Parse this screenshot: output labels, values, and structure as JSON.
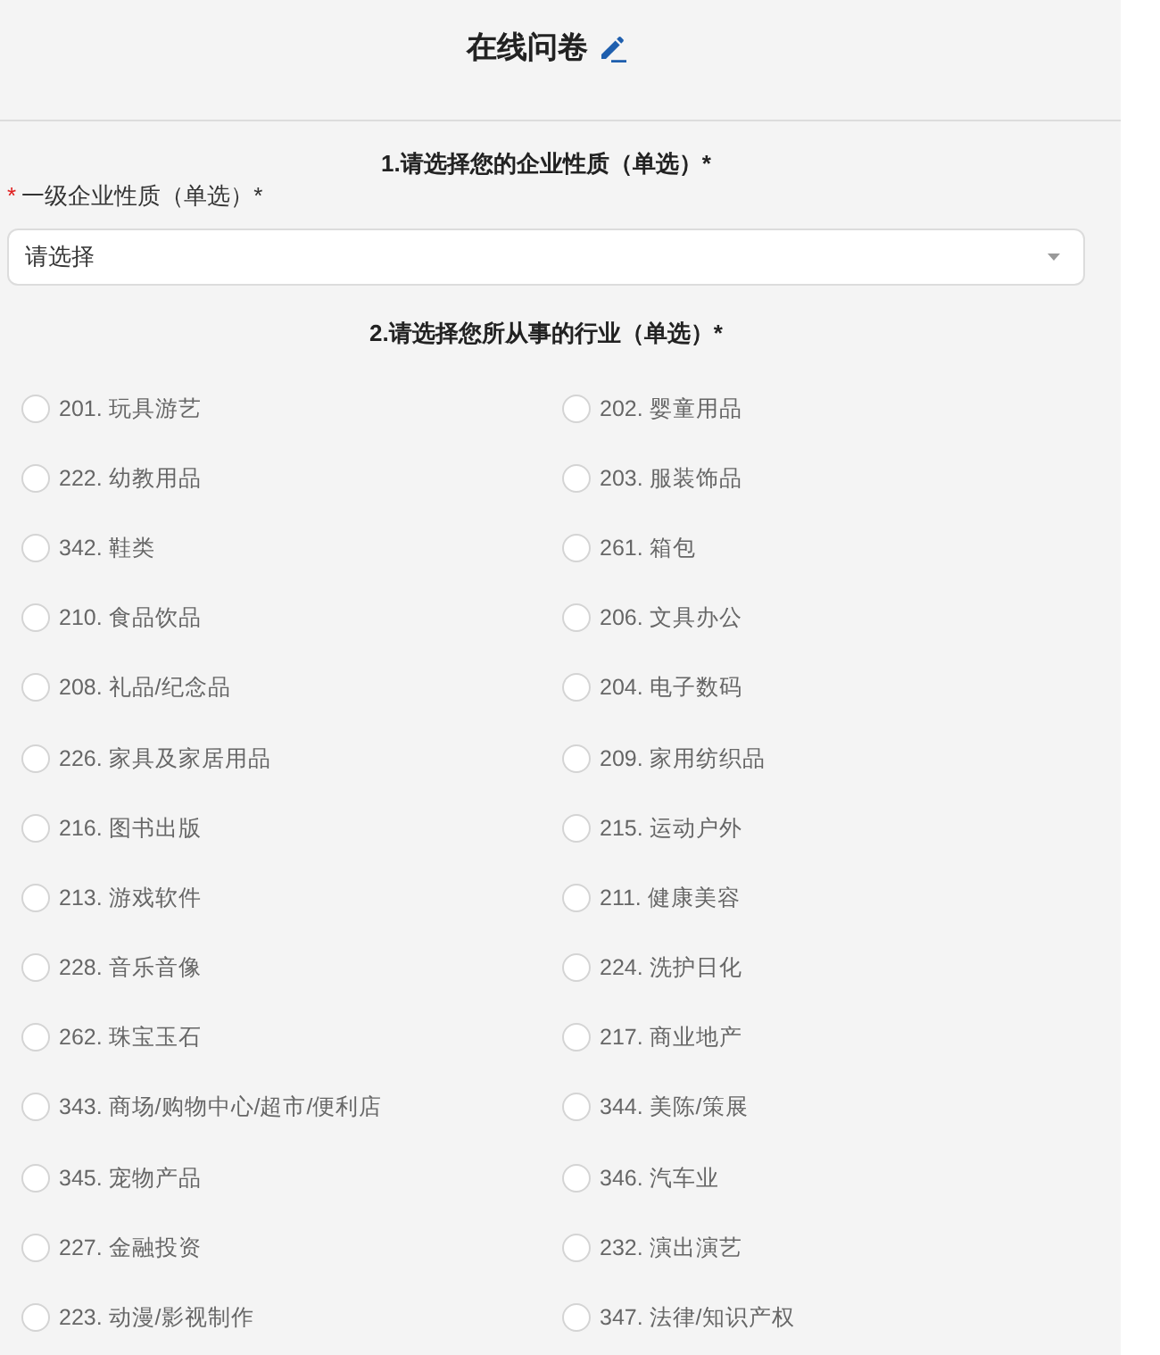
{
  "header": {
    "title": "在线问卷"
  },
  "questions": [
    {
      "kind": "select",
      "title": "1.请选择您的企业性质（单选）*",
      "field": {
        "required_mark": "*",
        "label": "一级企业性质（单选）*",
        "placeholder": "请选择"
      }
    },
    {
      "kind": "radio",
      "title": "2.请选择您所从事的行业（单选）*",
      "options": [
        {
          "label": "201. 玩具游艺",
          "selected": false
        },
        {
          "label": "202. 婴童用品",
          "selected": false
        },
        {
          "label": "222. 幼教用品",
          "selected": false
        },
        {
          "label": "203. 服装饰品",
          "selected": false
        },
        {
          "label": "342. 鞋类",
          "selected": false
        },
        {
          "label": "261. 箱包",
          "selected": false
        },
        {
          "label": "210. 食品饮品",
          "selected": false
        },
        {
          "label": "206. 文具办公",
          "selected": false
        },
        {
          "label": "208. 礼品/纪念品",
          "selected": false
        },
        {
          "label": "204. 电子数码",
          "selected": false
        },
        {
          "label": "226. 家具及家居用品",
          "selected": false
        },
        {
          "label": "209. 家用纺织品",
          "selected": false
        },
        {
          "label": "216. 图书出版",
          "selected": false
        },
        {
          "label": "215. 运动户外",
          "selected": false
        },
        {
          "label": "213. 游戏软件",
          "selected": false
        },
        {
          "label": "211. 健康美容",
          "selected": false
        },
        {
          "label": "228. 音乐音像",
          "selected": false
        },
        {
          "label": "224. 洗护日化",
          "selected": false
        },
        {
          "label": "262. 珠宝玉石",
          "selected": false
        },
        {
          "label": "217. 商业地产",
          "selected": false
        },
        {
          "label": "343. 商场/购物中心/超市/便利店",
          "selected": false
        },
        {
          "label": "344. 美陈/策展",
          "selected": false
        },
        {
          "label": "345. 宠物产品",
          "selected": false
        },
        {
          "label": "346. 汽车业",
          "selected": false
        },
        {
          "label": "227. 金融投资",
          "selected": false
        },
        {
          "label": "232. 演出演艺",
          "selected": false
        },
        {
          "label": "223. 动漫/影视制作",
          "selected": false
        },
        {
          "label": "347. 法律/知识产权",
          "selected": false
        }
      ]
    }
  ]
}
